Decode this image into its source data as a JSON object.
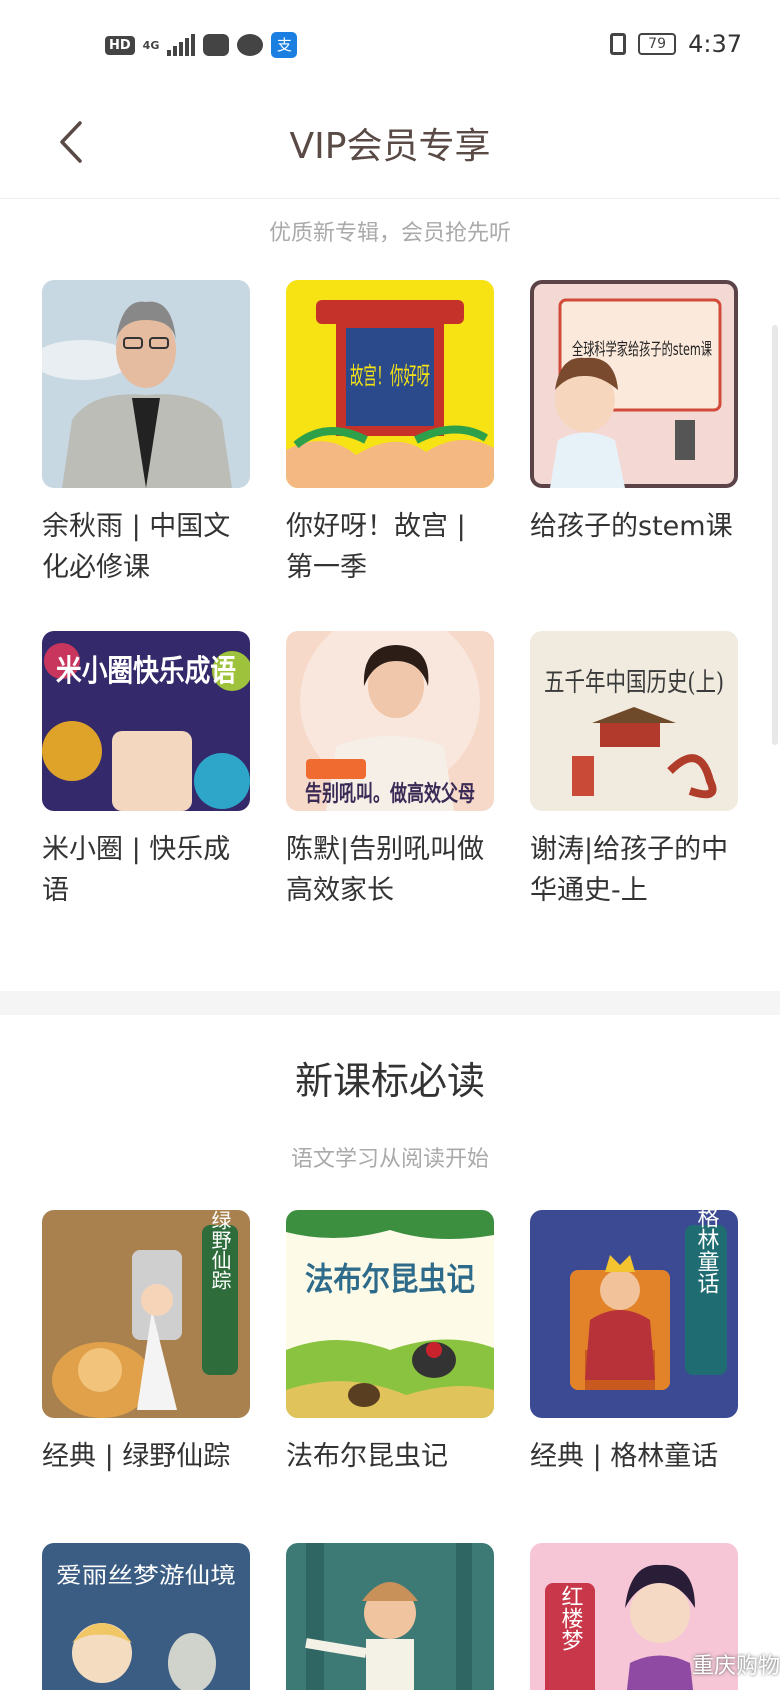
{
  "status": {
    "badge": "HD",
    "net": "4G",
    "battery": "79",
    "time": "4:37",
    "alipay": "支"
  },
  "nav": {
    "title": "VIP会员专享"
  },
  "section1": {
    "subtitle": "优质新专辑，会员抢先听",
    "items": [
      {
        "title": "余秋雨 | 中国文化必修课"
      },
      {
        "title": "你好呀！故宫 | 第一季",
        "cover_text": "故宫！你好呀"
      },
      {
        "title": "给孩子的stem课",
        "cover_text": "全球科学家给孩子的stem课"
      },
      {
        "title": "米小圈 | 快乐成语",
        "cover_text": "米小圈快乐成语"
      },
      {
        "title": "陈默|告别吼叫做高效家长",
        "cover_text": "告别吼叫。做高效父母"
      },
      {
        "title": "谢涛|给孩子的中华通史-上",
        "cover_text": "五千年中国历史(上)"
      }
    ]
  },
  "section2": {
    "title": "新课标必读",
    "subtitle": "语文学习从阅读开始",
    "items": [
      {
        "title": "经典 | 绿野仙踪",
        "cover_text": "绿野仙踪"
      },
      {
        "title": "法布尔昆虫记",
        "cover_text": "法布尔昆虫记"
      },
      {
        "title": "经典 | 格林童话",
        "cover_text": "格林童话"
      }
    ],
    "partial_items": [
      {
        "cover_text": "爱丽丝梦游仙境"
      },
      {
        "cover_text": ""
      },
      {
        "cover_text": "红楼梦"
      }
    ]
  },
  "watermark": "重庆购物",
  "colors": {
    "nav_title": "#5a4a45",
    "subtitle": "#aaaaaa",
    "divider": "#f5f5f5"
  }
}
